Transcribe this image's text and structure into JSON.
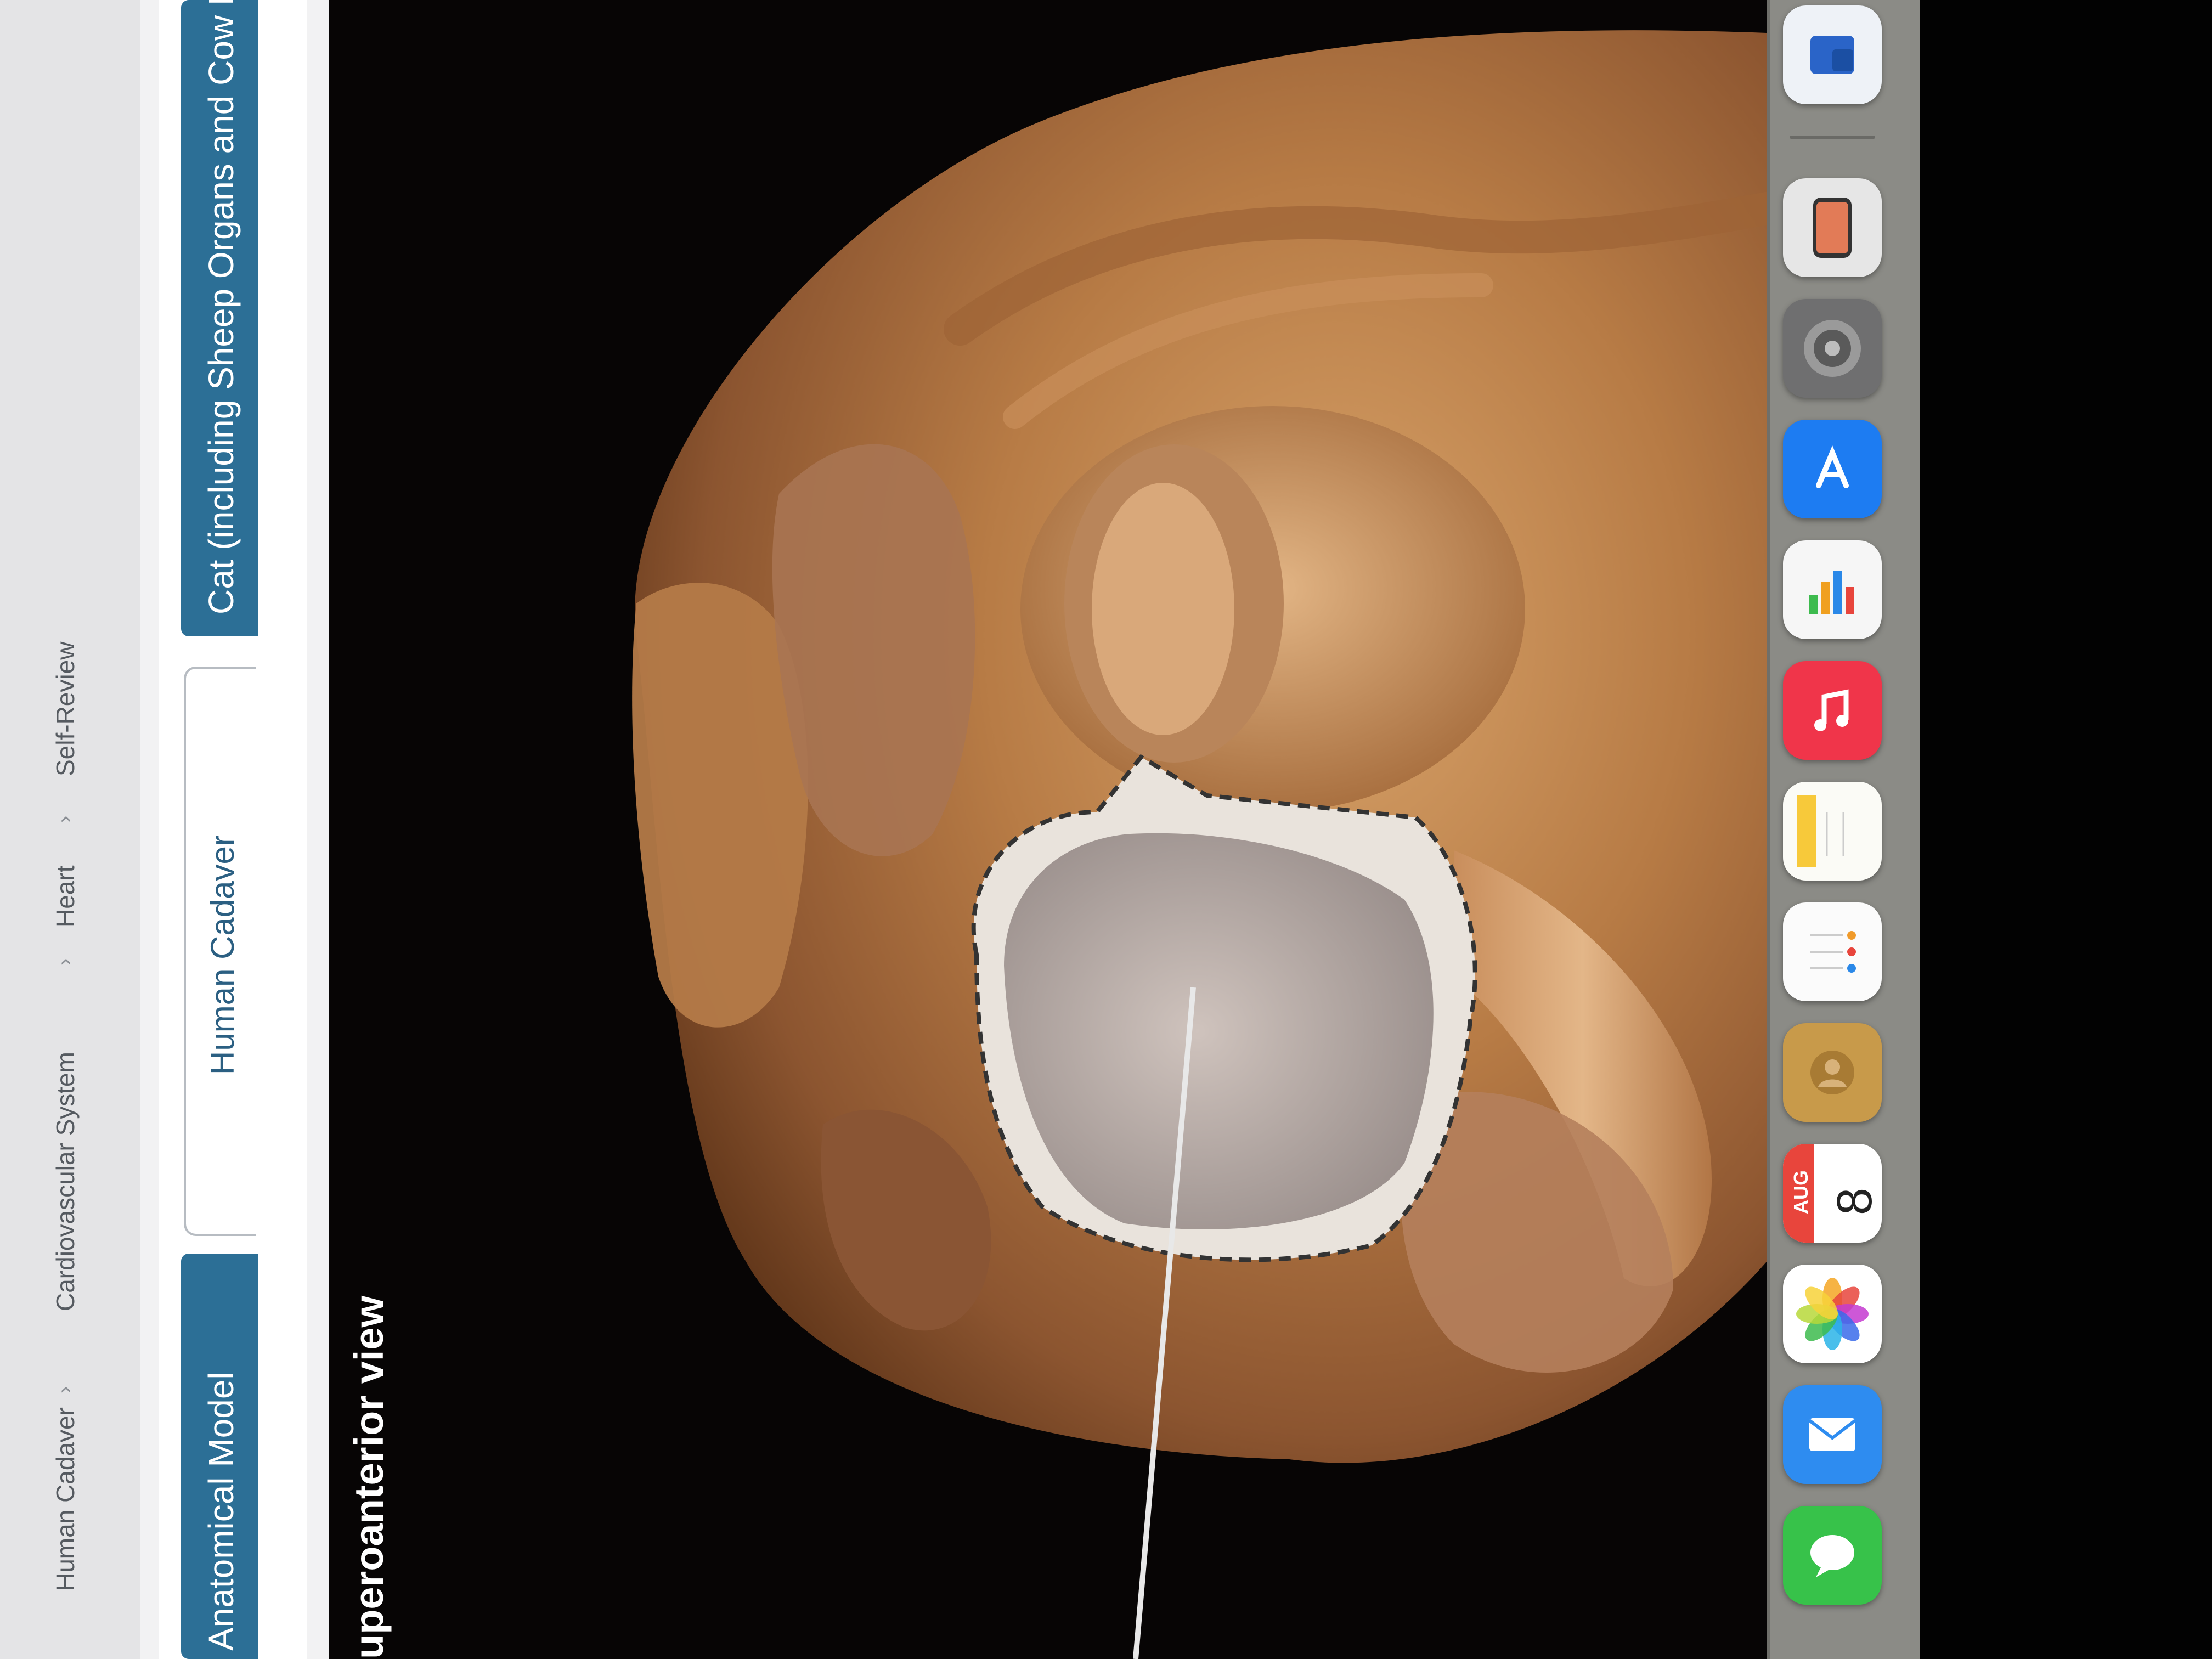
{
  "breadcrumb": [
    {
      "label": "Human Cadaver"
    },
    {
      "label": "Cardiovascular System"
    },
    {
      "label": "Heart"
    },
    {
      "label": "Self-Review"
    }
  ],
  "breadcrumb_separator": "›",
  "tabs": [
    {
      "label": "Anatomical Model",
      "active": true
    },
    {
      "label": "Human Cadaver",
      "active": false
    },
    {
      "label": "Cat (including Sheep Organs and Cow Eye)",
      "active": true
    }
  ],
  "viewer": {
    "title": "uperoanterior view"
  },
  "dock": {
    "calendar_month": "AUG",
    "calendar_day": "8",
    "icons": [
      {
        "name": "word-icon"
      },
      {
        "name": "iphone-mirroring-icon"
      },
      {
        "name": "system-settings-icon"
      },
      {
        "name": "app-store-icon"
      },
      {
        "name": "numbers-icon"
      },
      {
        "name": "music-icon"
      },
      {
        "name": "notes-icon"
      },
      {
        "name": "reminders-icon"
      },
      {
        "name": "contacts-icon"
      },
      {
        "name": "calendar-icon"
      },
      {
        "name": "photos-icon"
      },
      {
        "name": "mail-icon"
      },
      {
        "name": "messages-icon"
      }
    ]
  },
  "colors": {
    "tab_active": "#2c6f96",
    "viewer_background": "#070505",
    "dock_background": "#8b8b86"
  }
}
